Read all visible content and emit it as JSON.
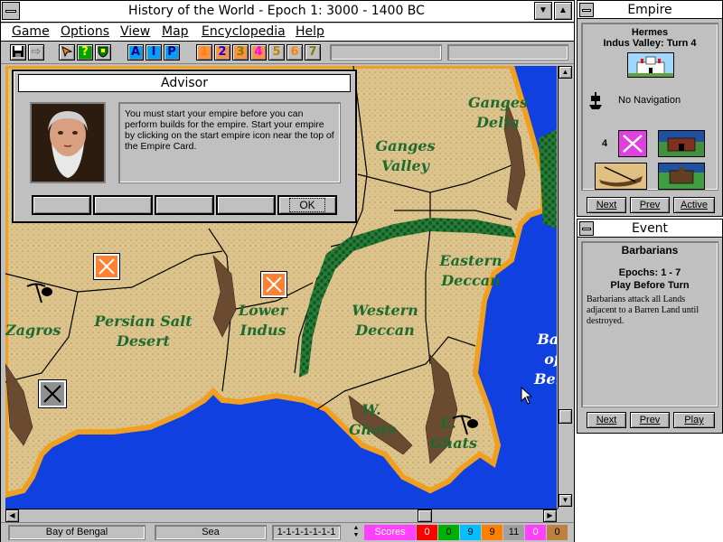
{
  "window": {
    "title": "History of the World - Epoch 1: 3000 - 1400 BC"
  },
  "menu": {
    "items": [
      "Game",
      "Options",
      "View",
      "Map",
      "Encyclopedia",
      "Help"
    ]
  },
  "toolbar": {
    "letter_buttons": [
      "A",
      "I",
      "P"
    ],
    "number_buttons": [
      "1",
      "2",
      "3",
      "4",
      "5",
      "6",
      "7"
    ],
    "number_colors": [
      "#ff8000",
      "#0000ff",
      "#808000",
      "#ff00ff",
      "#c08000",
      "#ff8000",
      "#808000"
    ]
  },
  "map": {
    "regions": [
      "Ganges Delta",
      "Ganges Valley",
      "Eastern Deccan",
      "Persian Salt Desert",
      "Lower Indus",
      "Western Deccan",
      "Zagros",
      "W. Ghats",
      "E. Ghats",
      "Bay of Bengal"
    ]
  },
  "advisor": {
    "title": "Advisor",
    "message": "You must start your empire before you can perform builds for the empire.  Start your empire by clicking on the start empire icon near the top of the Empire Card.",
    "buttons": [
      "",
      "",
      "",
      "",
      "OK"
    ]
  },
  "status": {
    "location": "Bay of Bengal",
    "terrain": "Sea",
    "code": "1-1-1-1-1-1-1",
    "scores_label": "Scores",
    "scores": [
      {
        "value": "0",
        "color": "#ff0000",
        "text": "#ffffff"
      },
      {
        "value": "0",
        "color": "#00b000",
        "text": "#000000"
      },
      {
        "value": "9",
        "color": "#00c0ff",
        "text": "#000000"
      },
      {
        "value": "9",
        "color": "#ff8000",
        "text": "#000000"
      },
      {
        "value": "11",
        "color": "#a0a0a0",
        "text": "#000000"
      },
      {
        "value": "0",
        "color": "#ff40ff",
        "text": "#ffffff"
      },
      {
        "value": "0",
        "color": "#c08040",
        "text": "#000000"
      }
    ]
  },
  "empire": {
    "title": "Empire",
    "name": "Hermes",
    "subtitle": "Indus Valley: Turn 4",
    "navigation": "No Navigation",
    "count": "4",
    "buttons": [
      "Next",
      "Prev",
      "Active"
    ]
  },
  "event": {
    "title": "Event",
    "name": "Barbarians",
    "epochs": "Epochs: 1 - 7",
    "play_note": "Play Before Turn",
    "description": "Barbarians attack all Lands adjacent to a Barren Land until destroyed.",
    "buttons": [
      "Next",
      "Prev",
      "Play"
    ]
  }
}
